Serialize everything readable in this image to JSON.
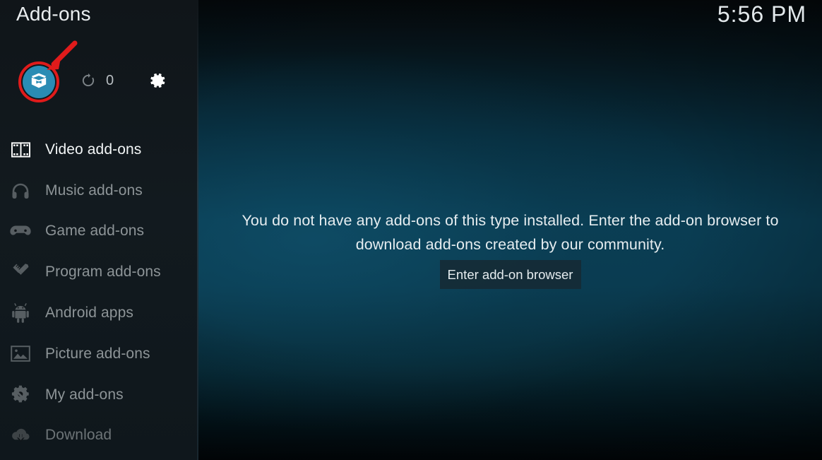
{
  "header": {
    "title": "Add-ons",
    "clock": "5:56 PM"
  },
  "toolbar": {
    "addon_browser_icon": "open-box-icon",
    "addon_browser_label": "Add-on browser",
    "refresh_icon": "refresh-icon",
    "refresh_count": "0",
    "settings_icon": "gear-icon",
    "accent_color": "#2a8cb4",
    "annotation_color": "#e01b1b"
  },
  "sidebar": {
    "items": [
      {
        "label": "Video add-ons",
        "icon": "film-strip-icon",
        "state": "active"
      },
      {
        "label": "Music add-ons",
        "icon": "headphones-icon",
        "state": "normal"
      },
      {
        "label": "Game add-ons",
        "icon": "gamepad-icon",
        "state": "normal"
      },
      {
        "label": "Program add-ons",
        "icon": "pencil-ruler-icon",
        "state": "normal"
      },
      {
        "label": "Android apps",
        "icon": "android-icon",
        "state": "normal"
      },
      {
        "label": "Picture add-ons",
        "icon": "picture-icon",
        "state": "normal"
      },
      {
        "label": "My add-ons",
        "icon": "gear-wrench-icon",
        "state": "normal"
      },
      {
        "label": "Download",
        "icon": "cloud-download-icon",
        "state": "dim"
      }
    ]
  },
  "main": {
    "empty_message": "You do not have any add-ons of this type installed. Enter the add-on browser to download add-ons created by our community.",
    "browse_button_label": "Enter add-on browser"
  }
}
